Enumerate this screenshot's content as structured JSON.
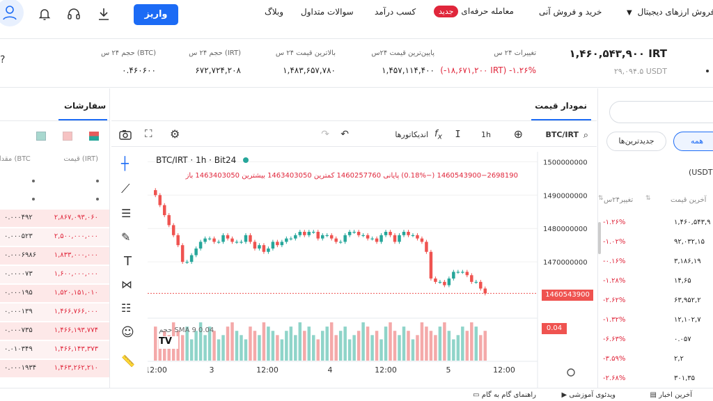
{
  "nav": {
    "crypto_menu": "خرید و فروش ارزهای دیجیتال",
    "instant": "خرید و فروش آنی",
    "pro_trade": "معامله حرفه‌ای",
    "new_badge": "جدید",
    "earn": "کسب درآمد",
    "faq": "سوالات متداول",
    "blog": "وبلاگ",
    "deposit": "واریز"
  },
  "stats": {
    "price_irt": "۱,۴۶۰,۵۴۳,۹۰۰ IRT",
    "price_usdt": "۲۹,۰۹۴.۵ USDT",
    "change_label": "تغییرات ۲۴ س",
    "change_value": "(-۱۸,۶۷۱,۲۰۰ IRT) -۱.۲۶%",
    "low_label": "پایین‌ترین قیمت ۲۴س",
    "low_value": "۱,۴۵۷,۱۱۴,۴۰۰",
    "high_label": "بالاترین قیمت ۲۴ س",
    "high_value": "۱,۴۸۳,۶۵۷,۷۸۰",
    "vol_irt_label": "حجم ۲۴ س (IRT)",
    "vol_irt_value": "۶۷۲,۷۲۴,۲۰۸",
    "vol_btc_label": "حجم ۲۴ س (BTC)",
    "vol_btc_value": "۰.۴۶۰۶۰۰"
  },
  "chart_panel": {
    "title": "نمودار قیمت",
    "symbol": "BTC/IRT",
    "interval": "1h",
    "indicators": "اندیکاتورها",
    "legend_title": "BTC/IRT · 1h · Bit24",
    "ohlc_line": "1460543900−2698190 (−0.18%)  پایانی 1460257760  کمترین 1463403050  بیشترین 1463403050  باز",
    "sma_label": "SMA 9  0.04",
    "volume_label": "حجم",
    "price_tag": "1460543900",
    "volume_tag": "0.04"
  },
  "chart_data": {
    "type": "candlestick",
    "y_ticks": [
      "1500000000",
      "1490000000",
      "1480000000",
      "1470000000"
    ],
    "y_tick_values": [
      1500000000,
      1490000000,
      1480000000,
      1470000000
    ],
    "x_ticks": [
      "12:00",
      "3",
      "12:00",
      "4",
      "12:00",
      "5",
      "12:00"
    ],
    "last_price": 1460543900,
    "closes": [
      1490000000,
      1487000000,
      1484000000,
      1481000000,
      1478000000,
      1475000000,
      1470000000,
      1470000000,
      1472000000,
      1474000000,
      1476000000,
      1477000000,
      1477000000,
      1476000000,
      1476000000,
      1478000000,
      1477000000,
      1476000000,
      1476000000,
      1476000000,
      1478000000,
      1476000000,
      1474000000,
      1475000000,
      1473000000,
      1474000000,
      1476000000,
      1475000000,
      1476000000,
      1477000000,
      1477000000,
      1478000000,
      1479000000,
      1478000000,
      1479000000,
      1479000000,
      1477000000,
      1478000000,
      1478000000,
      1477000000,
      1476000000,
      1476000000,
      1478000000,
      1479000000,
      1479000000,
      1478000000,
      1478000000,
      1477000000,
      1477000000,
      1476000000,
      1478000000,
      1479000000,
      1478000000,
      1476000000,
      1478000000,
      1479000000,
      1478000000,
      1478000000,
      1477000000,
      1476000000,
      1473000000,
      1465000000,
      1464000000,
      1464000000,
      1463000000,
      1465000000,
      1467000000,
      1467000000,
      1467000000,
      1466000000,
      1464000000,
      1464000000,
      1462000000,
      1460543900
    ],
    "volumes": [
      8,
      5,
      7,
      6,
      9,
      7,
      6,
      8,
      5,
      7,
      9,
      6,
      8,
      7,
      5,
      6,
      8,
      9,
      7,
      6,
      5,
      8,
      7,
      6,
      9,
      8,
      7,
      6,
      5,
      7,
      8,
      6,
      9,
      7,
      8,
      6,
      5,
      7,
      8,
      9,
      6,
      7,
      8,
      5,
      6,
      7,
      9,
      8,
      6,
      7,
      5,
      8,
      9,
      7,
      6,
      8,
      7,
      5,
      6,
      9,
      8,
      7,
      6,
      8,
      9,
      7,
      5,
      6,
      8,
      7,
      9,
      8,
      6,
      7
    ]
  },
  "orders": {
    "title": "سفارشات",
    "col_price": "قیمت (IRT)",
    "col_amount": "مقدار (BTC",
    "rows": [
      {
        "price": "۲,۸۶۷,۰۹۳,۰۶۰",
        "amount": "۰.۰۰۰۴۹۲"
      },
      {
        "price": "۲,۵۰۰,۰۰۰,۰۰۰",
        "amount": "۰.۰۰۰۵۲۳"
      },
      {
        "price": "۱,۸۳۳,۰۰۰,۰۰۰",
        "amount": "۰.۰۰۰۶۹۸۶"
      },
      {
        "price": "۱,۶۰۰,۰۰۰,۰۰۰",
        "amount": "۰.۰۰۰۰۷۳"
      },
      {
        "price": "۱,۵۲۰,۱۵۱,۰۱۰",
        "amount": "۰.۰۰۰۱۹۵"
      },
      {
        "price": "۱,۴۶۶,۷۶۶,۰۰۰",
        "amount": "۰.۰۰۰۱۳۹"
      },
      {
        "price": "۱,۴۶۶,۱۹۳,۷۷۴",
        "amount": "۰.۰۰۰۷۳۵"
      },
      {
        "price": "۱,۴۶۶,۱۴۳,۳۷۳",
        "amount": "۰.۰۱۰۳۴۹"
      },
      {
        "price": "۱,۴۶۳,۲۶۲,۲۱۰",
        "amount": "۰.۰۰۰۱۹۳۴"
      }
    ]
  },
  "market": {
    "tab_all": "همه",
    "tab_newest": "جدیدترین‌ها",
    "quote_label": "(USDT",
    "col_last": "آخرین قیمت",
    "col_change": "تغییر۲۴س",
    "rows": [
      {
        "change": "-۱.۲۶%",
        "price": "۱,۴۶۰,۵۴۳,۹"
      },
      {
        "change": "-۱.۰۲%",
        "price": "۹۲,۰۳۲,۱۵"
      },
      {
        "change": "-۰.۱۶%",
        "price": "۳,۱۸۶,۱۹"
      },
      {
        "change": "-۱.۲۸%",
        "price": "۱۴,۶۵"
      },
      {
        "change": "-۲.۶۲%",
        "price": "۶۳,۹۵۲,۲"
      },
      {
        "change": "-۱.۳۲%",
        "price": "۱۲,۱۰۲,۷"
      },
      {
        "change": "-۶.۶۳%",
        "price": "۰.۰۵۷"
      },
      {
        "change": "-۳.۵۹%",
        "price": "۲,۲"
      },
      {
        "change": "-۲.۶۸%",
        "price": "۳۰۱,۳۵"
      }
    ]
  },
  "footer": {
    "news": "آخرین اخبار",
    "video": "ویدئوی آموزشی",
    "guide": "راهنمای گام به گام"
  },
  "colors": {
    "accent": "#1c6bf5",
    "up": "#26a69a",
    "down": "#ef5350",
    "badge": "#e0263b"
  }
}
